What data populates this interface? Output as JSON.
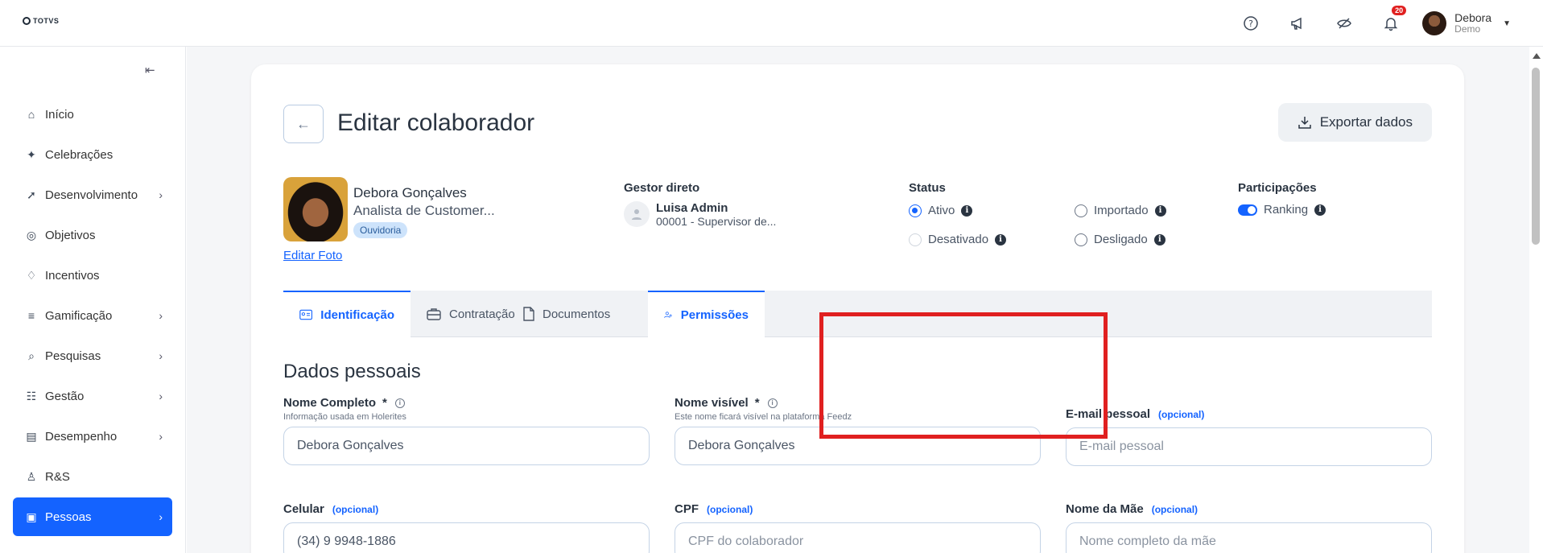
{
  "app": {
    "logo_text": "TOTVS"
  },
  "topbar": {
    "notifications_count": "20",
    "user_name": "Debora",
    "user_role": "Demo"
  },
  "sidebar": {
    "items": [
      {
        "label": "Início",
        "icon": "home-icon",
        "has_children": false,
        "active": false
      },
      {
        "label": "Celebrações",
        "icon": "party-icon",
        "has_children": false,
        "active": false
      },
      {
        "label": "Desenvolvimento",
        "icon": "rocket-icon",
        "has_children": true,
        "active": false
      },
      {
        "label": "Objetivos",
        "icon": "target-icon",
        "has_children": false,
        "active": false
      },
      {
        "label": "Incentivos",
        "icon": "handshake-icon",
        "has_children": false,
        "active": false
      },
      {
        "label": "Gamificação",
        "icon": "coins-icon",
        "has_children": true,
        "active": false
      },
      {
        "label": "Pesquisas",
        "icon": "search-chart-icon",
        "has_children": true,
        "active": false
      },
      {
        "label": "Gestão",
        "icon": "people-icon",
        "has_children": true,
        "active": false
      },
      {
        "label": "Desempenho",
        "icon": "clipboard-icon",
        "has_children": true,
        "active": false
      },
      {
        "label": "R&S",
        "icon": "user-search-icon",
        "has_children": false,
        "active": false
      },
      {
        "label": "Pessoas",
        "icon": "badge-icon",
        "has_children": true,
        "active": true
      }
    ]
  },
  "header": {
    "title": "Editar colaborador",
    "export_label": "Exportar dados"
  },
  "employee": {
    "name": "Debora Gonçalves",
    "role": "Analista de Customer...",
    "tag": "Ouvidoria",
    "edit_photo": "Editar Foto"
  },
  "manager": {
    "label": "Gestor direto",
    "name": "Luisa Admin",
    "sub": "00001 - Supervisor de..."
  },
  "status": {
    "label": "Status",
    "options": [
      {
        "label": "Ativo",
        "selected": true
      },
      {
        "label": "Importado",
        "selected": false
      },
      {
        "label": "Desativado",
        "selected": false
      },
      {
        "label": "Desligado",
        "selected": false
      }
    ]
  },
  "participations": {
    "label": "Participações",
    "ranking_label": "Ranking",
    "ranking_on": true
  },
  "tabs": [
    {
      "label": "Identificação",
      "icon": "id-card-icon"
    },
    {
      "label": "Contratação",
      "icon": "briefcase-icon"
    },
    {
      "label": "Documentos",
      "icon": "document-icon"
    },
    {
      "label": "Permissões",
      "icon": "users-key-icon"
    }
  ],
  "section": {
    "title": "Dados pessoais"
  },
  "fields": {
    "full_name": {
      "label": "Nome Completo",
      "required_mark": "*",
      "hint": "Informação usada em Holerites",
      "value": "Debora Gonçalves"
    },
    "visible_name": {
      "label": "Nome visível",
      "required_mark": "*",
      "hint": "Este nome ficará visível na plataforma Feedz",
      "value": "Debora Gonçalves"
    },
    "personal_email": {
      "label": "E-mail pessoal",
      "optional": "(opcional)",
      "placeholder": "E-mail pessoal"
    },
    "mobile": {
      "label": "Celular",
      "optional": "(opcional)",
      "value": "(34) 9 9948-1886"
    },
    "cpf": {
      "label": "CPF",
      "optional": "(opcional)",
      "placeholder": "CPF do colaborador"
    },
    "mother_name": {
      "label": "Nome da Mãe",
      "optional": "(opcional)",
      "placeholder": "Nome completo da mãe"
    }
  },
  "colors": {
    "accent": "#1463ff",
    "highlight": "#e02020"
  }
}
